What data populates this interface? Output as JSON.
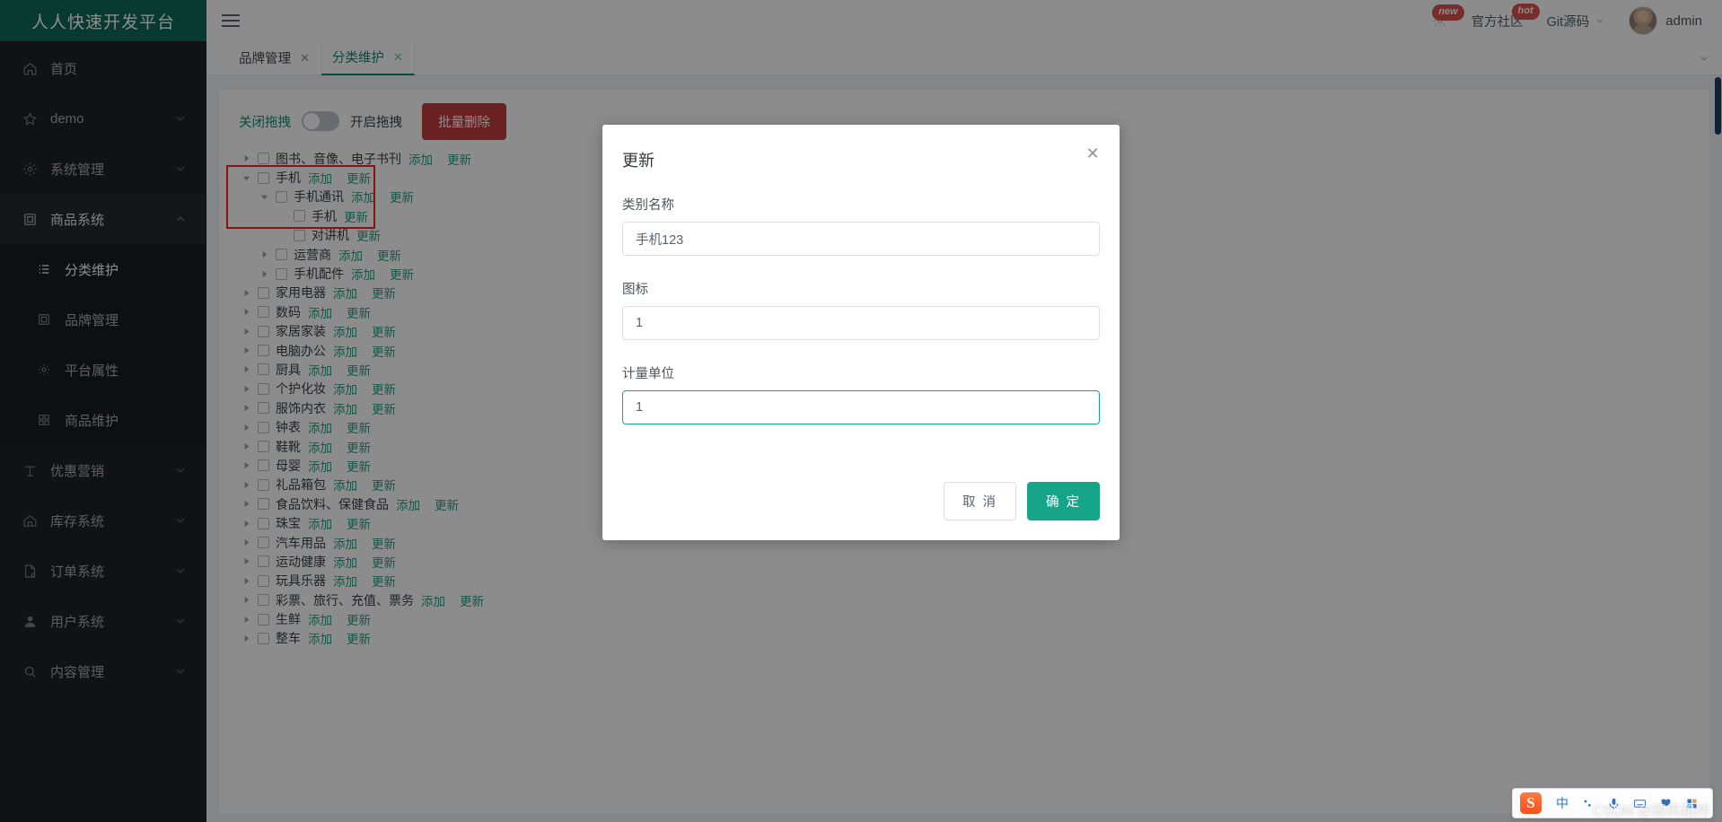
{
  "app": {
    "logo_title": "人人快速开发平台"
  },
  "header": {
    "hamburger": "menu-icon",
    "gear_badge": "new",
    "community_label": "官方社区",
    "community_badge": "hot",
    "git_label": "Git源码",
    "username": "admin"
  },
  "tabs": [
    {
      "label": "品牌管理",
      "close": "✕",
      "active": false
    },
    {
      "label": "分类维护",
      "close": "✕",
      "active": true
    }
  ],
  "sidebar": {
    "items": [
      {
        "label": "首页",
        "icon": "home-icon",
        "arrow": false
      },
      {
        "label": "demo",
        "icon": "star-icon",
        "arrow": true
      },
      {
        "label": "系统管理",
        "icon": "gear-icon",
        "arrow": true
      },
      {
        "label": "商品系统",
        "icon": "box-icon",
        "arrow": true,
        "expanded": true
      },
      {
        "label": "优惠营销",
        "icon": "tag-icon",
        "arrow": true
      },
      {
        "label": "库存系统",
        "icon": "warehouse-icon",
        "arrow": true
      },
      {
        "label": "订单系统",
        "icon": "order-icon",
        "arrow": true
      },
      {
        "label": "用户系统",
        "icon": "user-icon",
        "arrow": true
      },
      {
        "label": "内容管理",
        "icon": "search-icon",
        "arrow": true
      }
    ],
    "submenu": [
      {
        "label": "分类维护",
        "icon": "list-icon",
        "active": true
      },
      {
        "label": "品牌管理",
        "icon": "box-icon",
        "active": false
      },
      {
        "label": "平台属性",
        "icon": "gear-icon",
        "active": false,
        "arrow": true
      },
      {
        "label": "商品维护",
        "icon": "grid-icon",
        "active": false,
        "arrow": true
      }
    ]
  },
  "toolbar": {
    "drag_off_label": "关闭拖拽",
    "drag_on_label": "开启拖拽",
    "switch_state": "off",
    "bulk_delete_label": "批量删除"
  },
  "tree": {
    "action_add": "添加",
    "action_update": "更新",
    "nodes": [
      {
        "level": 0,
        "caret": "right",
        "label": "图书、音像、电子书刊",
        "actions": [
          "添加",
          "更新"
        ]
      },
      {
        "level": 0,
        "caret": "down",
        "label": "手机",
        "actions": [
          "添加",
          "更新"
        ]
      },
      {
        "level": 1,
        "caret": "down",
        "label": "手机通讯",
        "actions": [
          "添加",
          "更新"
        ]
      },
      {
        "level": 2,
        "caret": "none",
        "label": "手机",
        "actions": [
          "更新"
        ]
      },
      {
        "level": 2,
        "caret": "none",
        "label": "对讲机",
        "actions": [
          "更新"
        ]
      },
      {
        "level": 1,
        "caret": "right",
        "label": "运营商",
        "actions": [
          "添加",
          "更新"
        ]
      },
      {
        "level": 1,
        "caret": "right",
        "label": "手机配件",
        "actions": [
          "添加",
          "更新"
        ]
      },
      {
        "level": 0,
        "caret": "right",
        "label": "家用电器",
        "actions": [
          "添加",
          "更新"
        ]
      },
      {
        "level": 0,
        "caret": "right",
        "label": "数码",
        "actions": [
          "添加",
          "更新"
        ]
      },
      {
        "level": 0,
        "caret": "right",
        "label": "家居家装",
        "actions": [
          "添加",
          "更新"
        ]
      },
      {
        "level": 0,
        "caret": "right",
        "label": "电脑办公",
        "actions": [
          "添加",
          "更新"
        ]
      },
      {
        "level": 0,
        "caret": "right",
        "label": "厨具",
        "actions": [
          "添加",
          "更新"
        ]
      },
      {
        "level": 0,
        "caret": "right",
        "label": "个护化妆",
        "actions": [
          "添加",
          "更新"
        ]
      },
      {
        "level": 0,
        "caret": "right",
        "label": "服饰内衣",
        "actions": [
          "添加",
          "更新"
        ]
      },
      {
        "level": 0,
        "caret": "right",
        "label": "钟表",
        "actions": [
          "添加",
          "更新"
        ]
      },
      {
        "level": 0,
        "caret": "right",
        "label": "鞋靴",
        "actions": [
          "添加",
          "更新"
        ]
      },
      {
        "level": 0,
        "caret": "right",
        "label": "母婴",
        "actions": [
          "添加",
          "更新"
        ]
      },
      {
        "level": 0,
        "caret": "right",
        "label": "礼品箱包",
        "actions": [
          "添加",
          "更新"
        ]
      },
      {
        "level": 0,
        "caret": "right",
        "label": "食品饮料、保健食品",
        "actions": [
          "添加",
          "更新"
        ]
      },
      {
        "level": 0,
        "caret": "right",
        "label": "珠宝",
        "actions": [
          "添加",
          "更新"
        ]
      },
      {
        "level": 0,
        "caret": "right",
        "label": "汽车用品",
        "actions": [
          "添加",
          "更新"
        ]
      },
      {
        "level": 0,
        "caret": "right",
        "label": "运动健康",
        "actions": [
          "添加",
          "更新"
        ]
      },
      {
        "level": 0,
        "caret": "right",
        "label": "玩具乐器",
        "actions": [
          "添加",
          "更新"
        ]
      },
      {
        "level": 0,
        "caret": "right",
        "label": "彩票、旅行、充值、票务",
        "actions": [
          "添加",
          "更新"
        ]
      },
      {
        "level": 0,
        "caret": "right",
        "label": "生鲜",
        "actions": [
          "添加",
          "更新"
        ]
      },
      {
        "level": 0,
        "caret": "right",
        "label": "整车",
        "actions": [
          "添加",
          "更新"
        ]
      }
    ]
  },
  "modal": {
    "title": "更新",
    "close_icon": "✕",
    "fields": [
      {
        "label": "类别名称",
        "value": "手机123",
        "focused": false
      },
      {
        "label": "图标",
        "value": "1",
        "focused": false
      },
      {
        "label": "计量单位",
        "value": "1",
        "focused": true
      }
    ],
    "cancel_label": "取 消",
    "confirm_label": "确 定"
  },
  "ime": {
    "logo": "S",
    "mode": "中",
    "items": [
      "中",
      "°,",
      "mic-icon",
      "keyboard-icon",
      "emoji-icon",
      "apps-icon"
    ]
  },
  "watermark": "CSDN @硕风和炜",
  "colors": {
    "brand_green": "#0f6b5c",
    "accent_teal": "#17a589",
    "danger_red": "#c13c3c",
    "sidebar_dark": "#1f2124",
    "highlight_red": "#ff1f1f"
  }
}
